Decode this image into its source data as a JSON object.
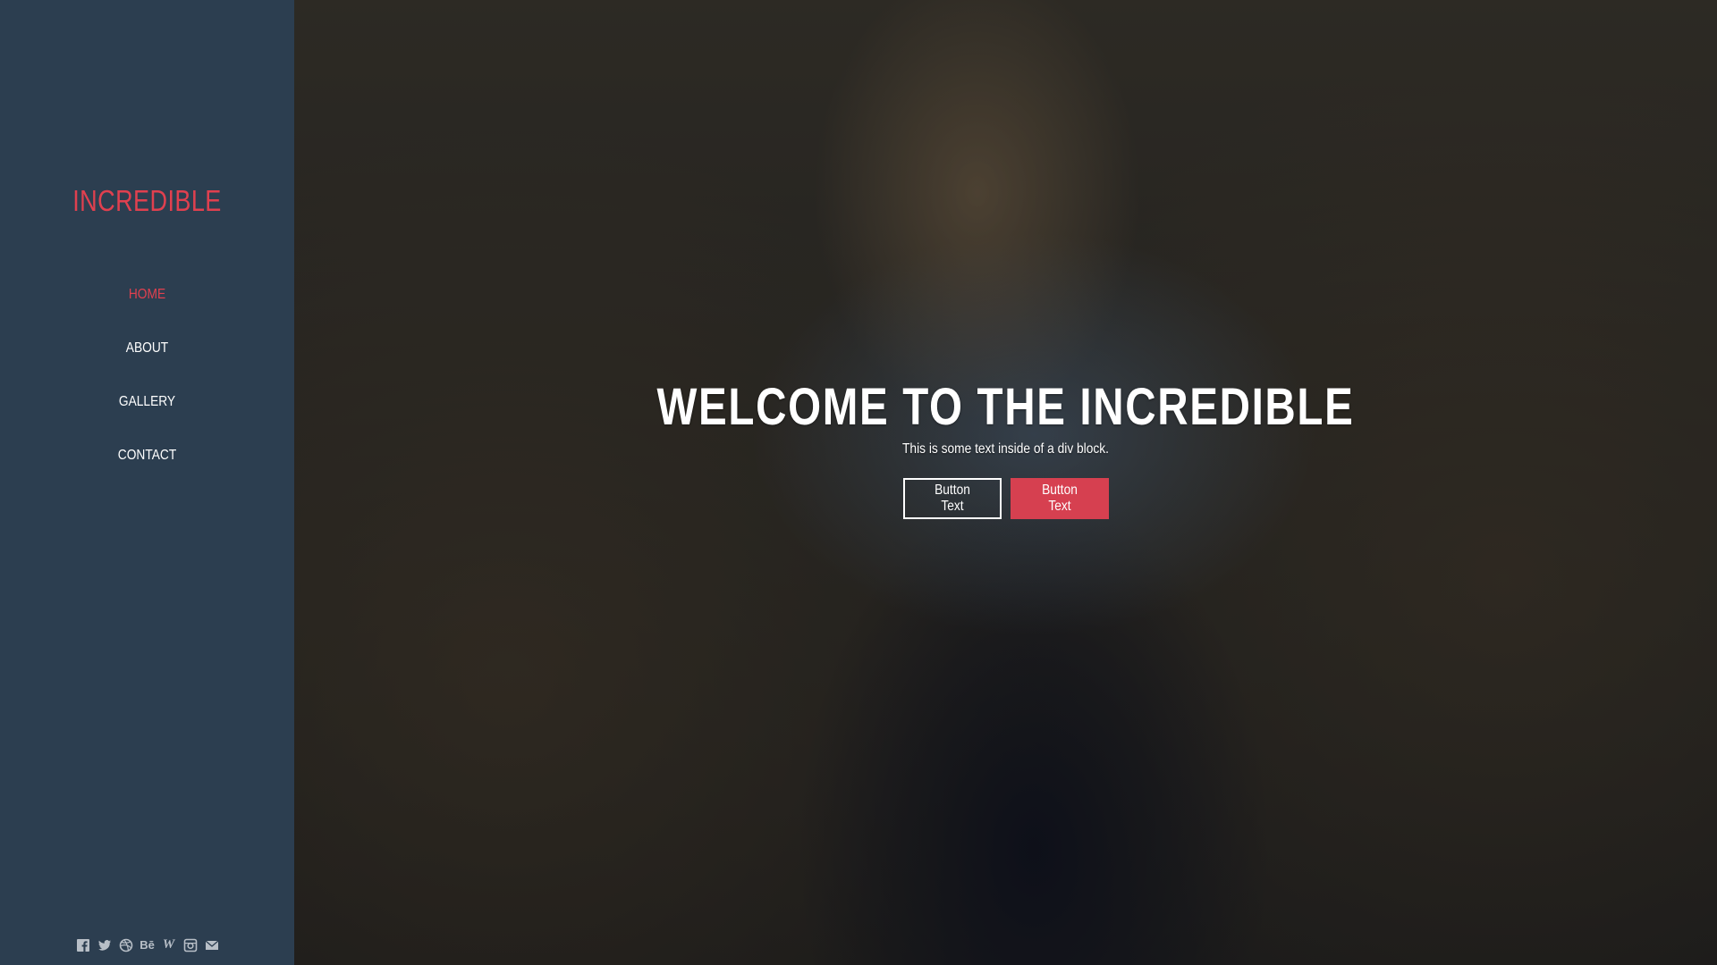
{
  "sidebar": {
    "brand": "INCREDIBLE",
    "brand_color": "#e0404f",
    "background": "#2c3e50",
    "nav": [
      {
        "label": "HOME",
        "active": true
      },
      {
        "label": "ABOUT",
        "active": false
      },
      {
        "label": "GALLERY",
        "active": false
      },
      {
        "label": "CONTACT",
        "active": false
      }
    ],
    "social_icons": [
      "facebook-icon",
      "twitter-icon",
      "dribbble-icon",
      "behance-icon",
      "wordpress-icon",
      "instagram-icon",
      "email-icon"
    ],
    "social_glyphs": {
      "behance": "Bē",
      "wordpress": "W"
    }
  },
  "hero": {
    "title": "WELCOME TO THE INCREDIBLE",
    "subtitle": "This is some text inside of a div block.",
    "buttons": [
      {
        "label": "Button Text",
        "style": "outline"
      },
      {
        "label": "Button Text",
        "style": "solid",
        "color": "#d64050"
      }
    ]
  }
}
